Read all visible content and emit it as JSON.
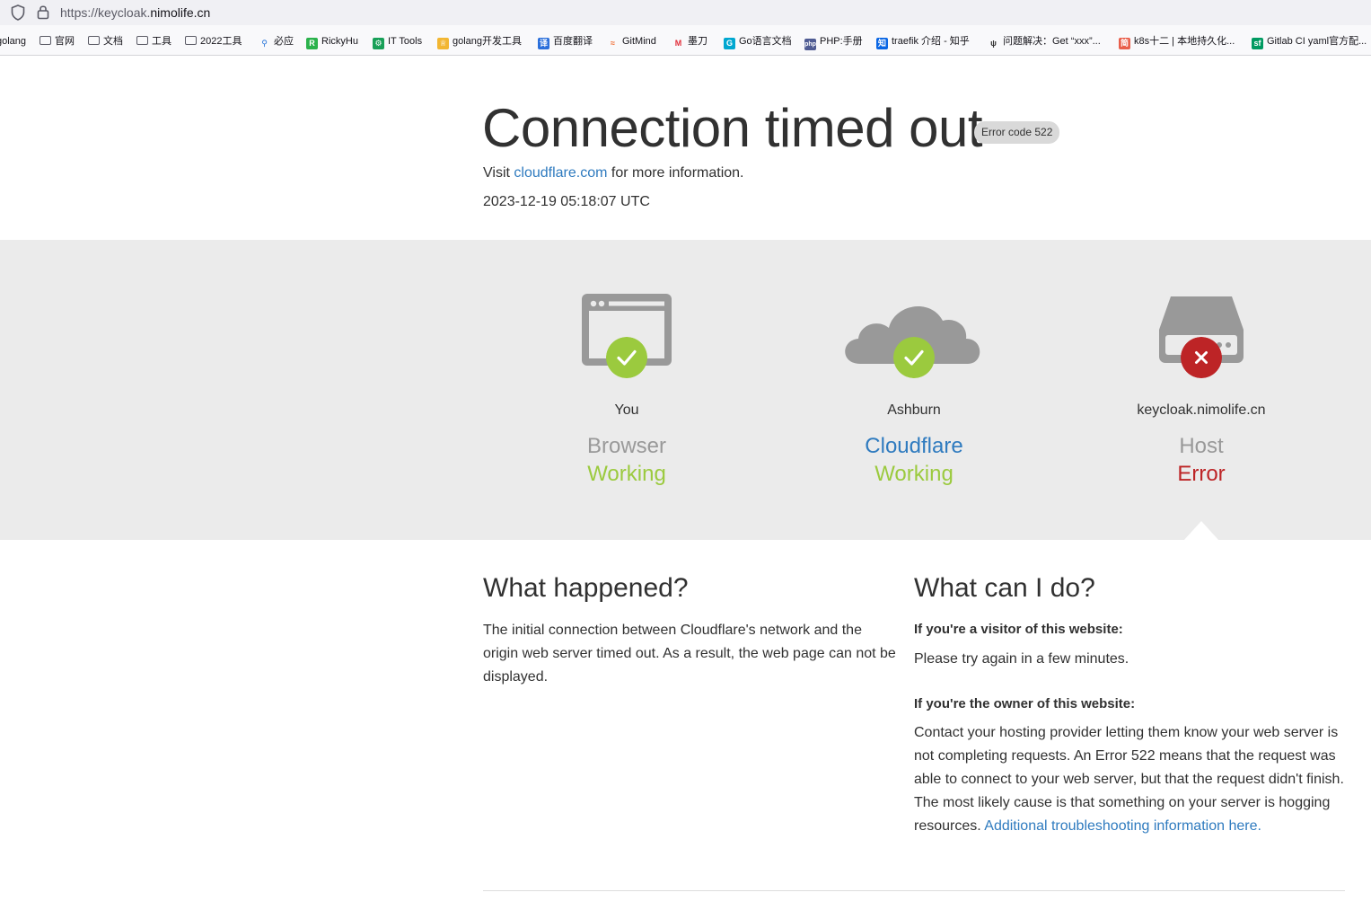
{
  "browser": {
    "url_prefix": "https://keycloak.",
    "url_host": "nimolife.cn",
    "bookmarks": [
      {
        "label": "golang",
        "icon": "none"
      },
      {
        "label": "官网",
        "icon": "folder"
      },
      {
        "label": "文档",
        "icon": "folder"
      },
      {
        "label": "工具",
        "icon": "folder"
      },
      {
        "label": "2022工具",
        "icon": "folder"
      },
      {
        "label": "必应",
        "icon": "search"
      },
      {
        "label": "RickyHu",
        "icon": "rickyhu"
      },
      {
        "label": "IT Tools",
        "icon": "it-tools"
      },
      {
        "label": "golang开发工具",
        "icon": "crown"
      },
      {
        "label": "百度翻译",
        "icon": "translate"
      },
      {
        "label": "GitMind",
        "icon": "gitmind"
      },
      {
        "label": "墨刀",
        "icon": "modao"
      },
      {
        "label": "Go语言文档",
        "icon": "go"
      },
      {
        "label": "PHP:手册",
        "icon": "php"
      },
      {
        "label": "traefik 介绍 - 知乎",
        "icon": "zhihu"
      },
      {
        "label": "问题解决：Get “xxx”...",
        "icon": "bug"
      },
      {
        "label": "k8s十二 | 本地持久化...",
        "icon": "jianshu"
      },
      {
        "label": "Gitlab CI yaml官方配...",
        "icon": "sf"
      }
    ]
  },
  "header": {
    "title": "Connection timed out",
    "error_code": "Error code 522",
    "visit_prefix": "Visit ",
    "visit_link": "cloudflare.com",
    "visit_suffix": " for more information.",
    "timestamp": "2023-12-19 05:18:07 UTC"
  },
  "status": [
    {
      "location": "You",
      "role": "Browser",
      "state": "Working",
      "ok": true,
      "icon": "browser-icon"
    },
    {
      "location": "Ashburn",
      "role": "Cloudflare",
      "state": "Working",
      "ok": true,
      "icon": "cloud-icon"
    },
    {
      "location": "keycloak.nimolife.cn",
      "role": "Host",
      "state": "Error",
      "ok": false,
      "icon": "server-icon"
    }
  ],
  "colors": {
    "ok": "#9bca3e",
    "error": "#bd2426",
    "link": "#2f7bbf",
    "icon_gray": "#999999"
  },
  "what_happened": {
    "heading": "What happened?",
    "body": "The initial connection between Cloudflare's network and the origin web server timed out. As a result, the web page can not be displayed."
  },
  "what_can_i_do": {
    "heading": "What can I do?",
    "visitor_heading": "If you're a visitor of this website:",
    "visitor_body": "Please try again in a few minutes.",
    "owner_heading": "If you're the owner of this website:",
    "owner_body": "Contact your hosting provider letting them know your web server is not completing requests. An Error 522 means that the request was able to connect to your web server, but that the request didn't finish. The most likely cause is that something on your server is hogging resources. ",
    "owner_link": "Additional troubleshooting information here."
  }
}
